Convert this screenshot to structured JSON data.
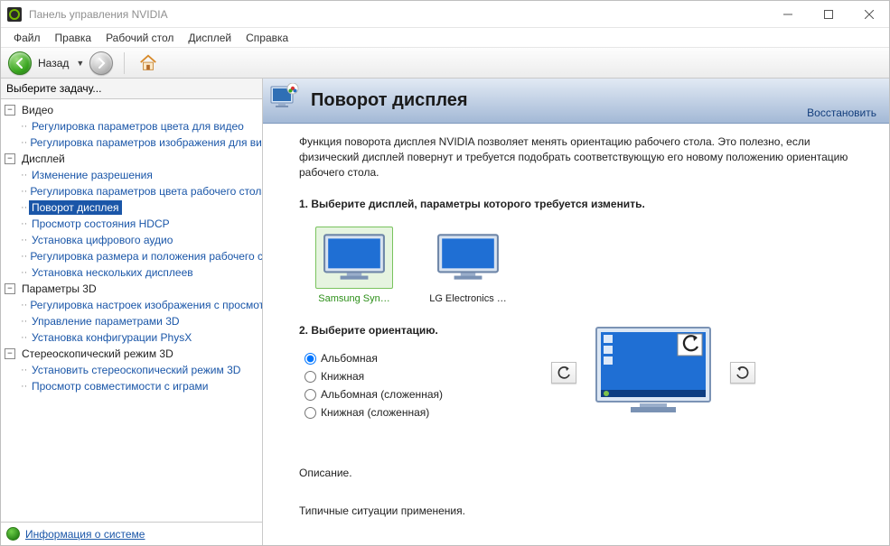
{
  "window": {
    "title": "Панель управления NVIDIA"
  },
  "menu": [
    "Файл",
    "Правка",
    "Рабочий стол",
    "Дисплей",
    "Справка"
  ],
  "toolbar": {
    "back_label": "Назад"
  },
  "sidebar": {
    "header": "Выберите задачу...",
    "groups": [
      {
        "label": "Видео",
        "items": [
          "Регулировка параметров цвета для видео",
          "Регулировка параметров изображения для видео"
        ]
      },
      {
        "label": "Дисплей",
        "items": [
          "Изменение разрешения",
          "Регулировка параметров цвета рабочего стола",
          "Поворот дисплея",
          "Просмотр состояния HDCP",
          "Установка цифрового аудио",
          "Регулировка размера и положения рабочего стола",
          "Установка нескольких дисплеев"
        ],
        "selected": 2
      },
      {
        "label": "Параметры 3D",
        "items": [
          "Регулировка настроек изображения с просмотром",
          "Управление параметрами 3D",
          "Установка конфигурации PhysX"
        ]
      },
      {
        "label": "Стереоскопический режим 3D",
        "items": [
          "Установить стереоскопический режим 3D",
          "Просмотр совместимости с играми"
        ]
      }
    ],
    "info_link": "Информация о системе"
  },
  "main": {
    "title": "Поворот дисплея",
    "restore": "Восстановить",
    "description": "Функция поворота дисплея NVIDIA позволяет менять ориентацию рабочего стола. Это полезно, если физический дисплей повернут и требуется подобрать соответствующую его новому положению ориентацию рабочего стола.",
    "section1": "1. Выберите дисплей, параметры которого требуется изменить.",
    "displays": [
      {
        "label": "Samsung Syn…",
        "selected": true
      },
      {
        "label": "LG Electronics …",
        "selected": false
      }
    ],
    "section2": "2. Выберите ориентацию.",
    "orientations": [
      {
        "label": "Альбомная",
        "checked": true
      },
      {
        "label": "Книжная",
        "checked": false
      },
      {
        "label": "Альбомная (сложенная)",
        "checked": false
      },
      {
        "label": "Книжная (сложенная)",
        "checked": false
      }
    ],
    "footer1": "Описание.",
    "footer2": "Типичные ситуации применения."
  }
}
